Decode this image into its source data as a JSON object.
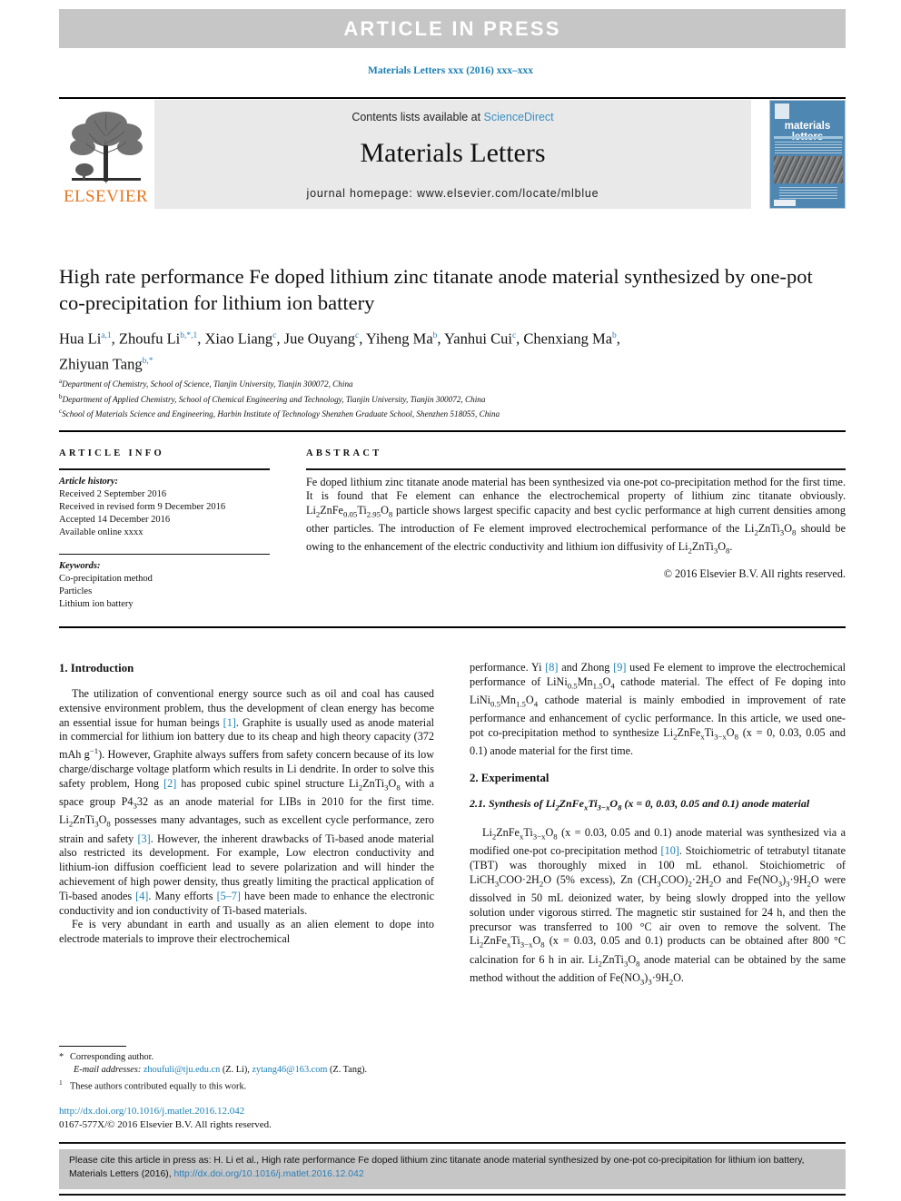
{
  "banner": {
    "text": "ARTICLE  IN  PRESS"
  },
  "running_head": {
    "text": "Materials Letters xxx (2016) xxx–xxx"
  },
  "masthead": {
    "contents_prefix": "Contents lists available at ",
    "sciencedirect": "ScienceDirect",
    "journal_title": "Materials Letters",
    "homepage": "journal homepage: www.elsevier.com/locate/mlblue",
    "elsevier_wordmark": "ELSEVIER",
    "cover_title": "materials letters",
    "accent_blue": "#1a7fb5",
    "elsevier_orange": "#e87722",
    "banner_gray": "#c6c6c6"
  },
  "article": {
    "title": "High rate performance Fe doped lithium zinc titanate anode material synthesized by one-pot co-precipitation for lithium ion battery",
    "affiliations": [
      {
        "mark": "a",
        "text": "Department of Chemistry, School of Science, Tianjin University, Tianjin 300072, China"
      },
      {
        "mark": "b",
        "text": "Department of Applied Chemistry, School of Chemical Engineering and Technology, Tianjin University, Tianjin 300072, China"
      },
      {
        "mark": "c",
        "text": "School of Materials Science and Engineering, Harbin Institute of Technology Shenzhen Graduate School, Shenzhen 518055, China"
      }
    ]
  },
  "info": {
    "label": "ARTICLE INFO",
    "history_head": "Article history:",
    "history": [
      "Received 2 September 2016",
      "Received in revised form 9 December 2016",
      "Accepted 14 December 2016",
      "Available online xxxx"
    ],
    "keywords_head": "Keywords:",
    "keywords": [
      "Co-precipitation method",
      "Particles",
      "Lithium ion battery"
    ]
  },
  "abstract": {
    "label": "ABSTRACT",
    "copyright": "© 2016 Elsevier B.V. All rights reserved."
  },
  "sections": {
    "introduction_head": "1. Introduction",
    "experimental_head": "2. Experimental",
    "synthesis_sub_prefix": "2.1. Synthesis of Li"
  },
  "footnotes": {
    "corresponding": "Corresponding author.",
    "email_label": "E-mail addresses:",
    "email1": "zhoufuli@tju.edu.cn",
    "email1_who": "(Z. Li),",
    "email2": "zytang46@163.com",
    "email2_who": "(Z. Tang).",
    "equal_contrib": "These authors contributed equally to this work.",
    "doi": "http://dx.doi.org/10.1016/j.matlet.2016.12.042",
    "issn": "0167-577X/© 2016 Elsevier B.V. All rights reserved."
  },
  "cite": {
    "prefix": "Please cite this article in press as: H. Li et al., High rate performance Fe doped lithium zinc titanate anode material synthesized by one-pot co-precipitation for lithium ion battery, Materials Letters (2016), ",
    "link": "http://dx.doi.org/10.1016/j.matlet.2016.12.042"
  }
}
